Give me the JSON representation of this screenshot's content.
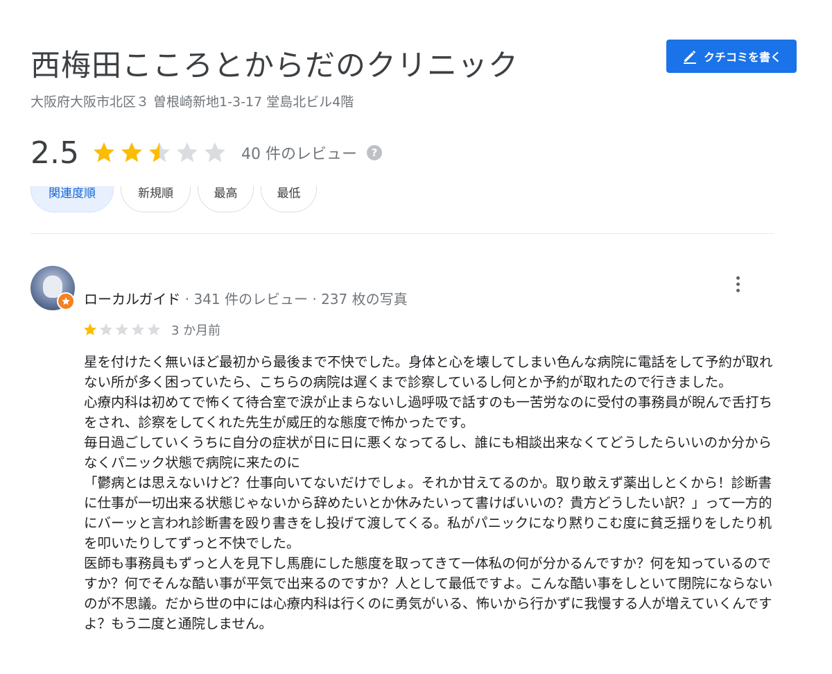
{
  "place": {
    "title": "西梅田こころとからだのクリニック",
    "address": "大阪府大阪市北区３ 曽根崎新地1-3-17 堂島北ビル4階"
  },
  "write_review_button": {
    "label": "クチコミを書く",
    "icon": "pencil-icon"
  },
  "summary": {
    "rating": "2.5",
    "rating_value": 2.5,
    "max_rating": 5,
    "review_count": "40 件のレビュー",
    "help_icon": "?"
  },
  "sort_chips": [
    {
      "label": "関連度順",
      "active": true
    },
    {
      "label": "新規順",
      "active": false
    },
    {
      "label": "最高",
      "active": false
    },
    {
      "label": "最低",
      "active": false
    }
  ],
  "review": {
    "reviewer_name": "ローカルガイド",
    "reviewer_meta": " · 341 件のレビュー · 237 枚の写真",
    "rating_value": 1,
    "max_rating": 5,
    "time": "3 か月前",
    "body": "星を付けたく無いほど最初から最後まで不快でした。身体と心を壊してしまい色んな病院に電話をして予約が取れない所が多く困っていたら、こちらの病院は遅くまで診察しているし何とか予約が取れたので行きました。\n心療内科は初めてで怖くて待合室で涙が止まらないし過呼吸で話すのも一苦労なのに受付の事務員が睨んで舌打ちをされ、診察をしてくれた先生が威圧的な態度で怖かったです。\n毎日過ごしていくうちに自分の症状が日に日に悪くなってるし、誰にも相談出来なくてどうしたらいいのか分からなくパニック状態で病院に来たのに\n「鬱病とは思えないけど？仕事向いてないだけでしょ。それか甘えてるのか。取り敢えず薬出しとくから！診断書に仕事が一切出来る状態じゃないから辞めたいとか休みたいって書けばいいの？貴方どうしたい訳？」って一方的にバーッと言われ診断書を殴り書きをし投げて渡してくる。私がパニックになり黙りこむ度に貧乏揺りをしたり机を叩いたりしてずっと不快でした。\n医師も事務員もずっと人を見下し馬鹿にした態度を取ってきて一体私の何が分かるんですか？何を知っているのですか？何でそんな酷い事が平気で出来るのですか？人として最低ですよ。こんな酷い事をしといて閉院にならないのが不思議。だから世の中には心療内科は行くのに勇気がいる、怖いから行かずに我慢する人が増えていくんですよ？もう二度と通院しません。"
  },
  "colors": {
    "star_filled": "#fbbc04",
    "star_empty": "#dadce0",
    "accent": "#1a73e8",
    "badge": "#f4821f"
  }
}
